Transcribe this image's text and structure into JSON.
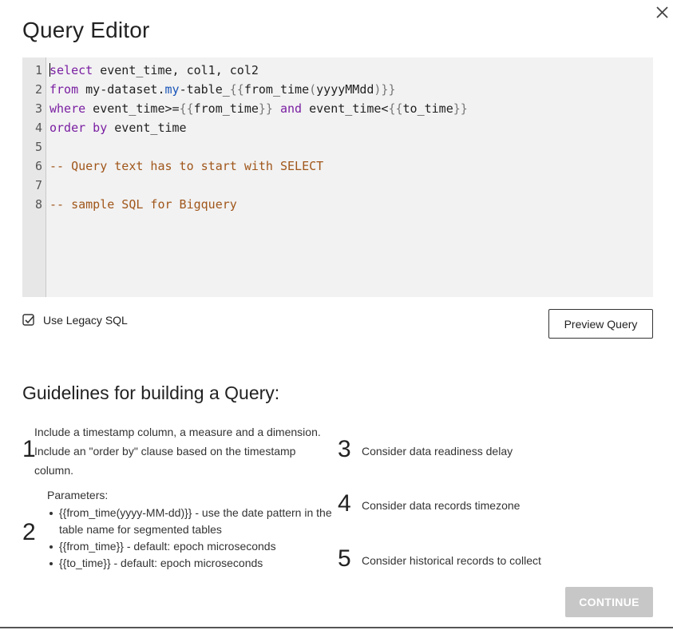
{
  "dialog": {
    "title": "Query Editor",
    "close_icon": "close-icon"
  },
  "editor": {
    "line_numbers": [
      "1",
      "2",
      "3",
      "4",
      "5",
      "6",
      "7",
      "8"
    ],
    "lines": [
      [
        {
          "t": "select",
          "c": "kw"
        },
        {
          "t": " event_time, col1, col2",
          "c": ""
        }
      ],
      [
        {
          "t": "from",
          "c": "kw"
        },
        {
          "t": " my-dataset.",
          "c": ""
        },
        {
          "t": "my",
          "c": "blue"
        },
        {
          "t": "-table_",
          "c": ""
        },
        {
          "t": "{{",
          "c": "tpl"
        },
        {
          "t": "from_time",
          "c": ""
        },
        {
          "t": "(",
          "c": "tpl"
        },
        {
          "t": "yyyyMMdd",
          "c": ""
        },
        {
          "t": ")}}",
          "c": "tpl"
        }
      ],
      [
        {
          "t": "where",
          "c": "kw"
        },
        {
          "t": " event_time>=",
          "c": ""
        },
        {
          "t": "{{",
          "c": "tpl"
        },
        {
          "t": "from_time",
          "c": ""
        },
        {
          "t": "}}",
          "c": "tpl"
        },
        {
          "t": " ",
          "c": ""
        },
        {
          "t": "and",
          "c": "kw"
        },
        {
          "t": " event_time<",
          "c": ""
        },
        {
          "t": "{{",
          "c": "tpl"
        },
        {
          "t": "to_time",
          "c": ""
        },
        {
          "t": "}}",
          "c": "tpl"
        }
      ],
      [
        {
          "t": "order by",
          "c": "kw"
        },
        {
          "t": " event_time",
          "c": ""
        }
      ],
      [],
      [
        {
          "t": "-- Query text has to start with SELECT",
          "c": "cm"
        }
      ],
      [],
      [
        {
          "t": "-- sample SQL for Bigquery",
          "c": "cm"
        }
      ]
    ]
  },
  "legacy_sql": {
    "label": "Use Legacy SQL",
    "checked": true
  },
  "buttons": {
    "preview": "Preview Query",
    "continue": "CONTINUE"
  },
  "guidelines": {
    "title": "Guidelines for building a Query:",
    "items": [
      {
        "num": "1",
        "text": [
          "Include a timestamp column, a measure and a dimension.",
          "Include an \"order by\" clause based on the timestamp",
          "column."
        ]
      },
      {
        "num": "2",
        "params_title": "Parameters:",
        "bullets": [
          "{{from_time(yyyy-MM-dd)}} - use the date pattern in the table name for segmented tables",
          "{{from_time}} - default: epoch microseconds",
          "{{to_time}} - default: epoch microseconds"
        ]
      },
      {
        "num": "3",
        "text": "Consider data readiness delay"
      },
      {
        "num": "4",
        "text": "Consider data records timezone"
      },
      {
        "num": "5",
        "text": "Consider historical records to collect"
      }
    ]
  },
  "colors": {
    "keyword": "#7a1fa2",
    "template": "#777777",
    "comment": "#a0561a",
    "continue_disabled": "#c7c7c7"
  }
}
